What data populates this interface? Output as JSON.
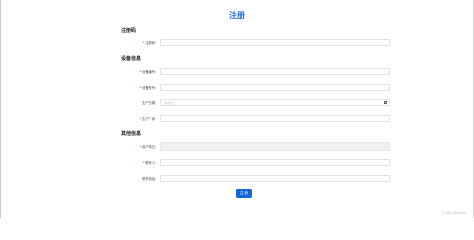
{
  "title": "注册",
  "sections": {
    "registration_code": "注册码",
    "device_info": "设备信息",
    "other_info": "其他信息"
  },
  "fields": {
    "registration_code": {
      "label": "注册码:",
      "required": "*",
      "placeholder": ""
    },
    "device_serial": {
      "label": "设备编号:",
      "required": "*",
      "placeholder": ""
    },
    "device_model": {
      "label": "设备型号:",
      "required": "*",
      "placeholder": ""
    },
    "production_date": {
      "label": "生产日期:",
      "value": "年/月/日"
    },
    "manufacturer": {
      "label": "生产厂家:",
      "required": "*",
      "placeholder": ""
    },
    "user_unit": {
      "label": "用户单位:",
      "required": "*",
      "placeholder": ""
    },
    "contact_person": {
      "label": "联系人:",
      "required": "*",
      "placeholder": ""
    },
    "contact_phone": {
      "label": "联系电话:",
      "placeholder": ""
    }
  },
  "submit_label": "注 册",
  "footer_watermark": "CSDN @gzi5u"
}
